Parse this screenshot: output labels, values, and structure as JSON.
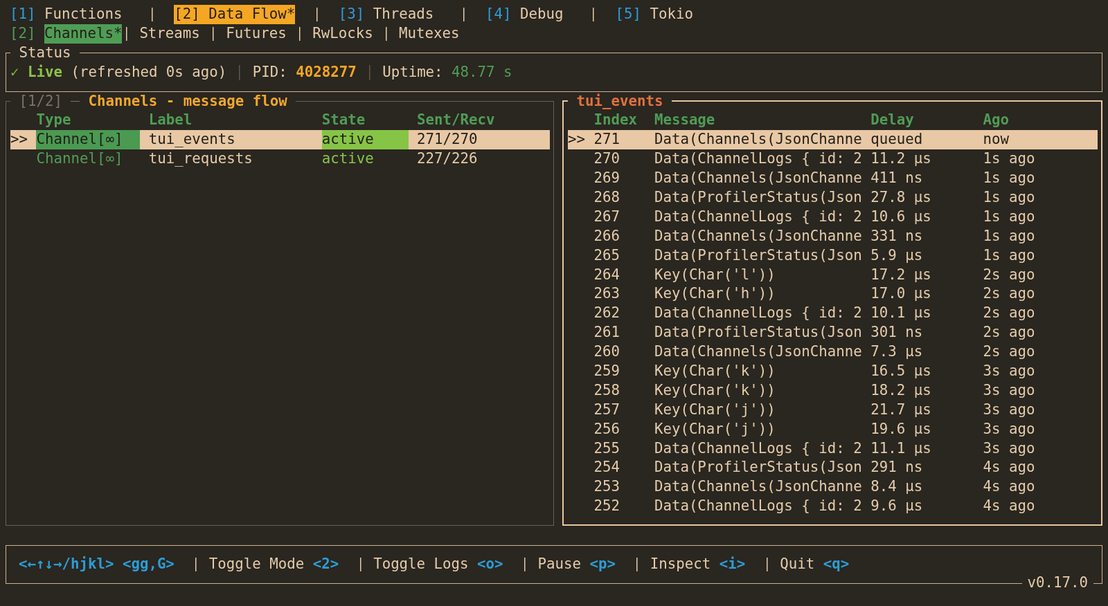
{
  "tabs": [
    {
      "number": "[1]",
      "label": "Functions",
      "selected": false
    },
    {
      "number": "[2]",
      "label": "Data Flow*",
      "selected": true
    },
    {
      "number": "[3]",
      "label": "Threads",
      "selected": false
    },
    {
      "number": "[4]",
      "label": "Debug",
      "selected": false
    },
    {
      "number": "[5]",
      "label": "Tokio",
      "selected": false
    }
  ],
  "subtabs": {
    "number": "[2]",
    "items": [
      {
        "label": "Channels*",
        "selected": true
      },
      {
        "label": "Streams",
        "selected": false
      },
      {
        "label": "Futures",
        "selected": false
      },
      {
        "label": "RwLocks",
        "selected": false
      },
      {
        "label": "Mutexes",
        "selected": false
      }
    ]
  },
  "status": {
    "title": "Status",
    "indicator": "✓",
    "state": "Live",
    "refreshed": "(refreshed 0s ago)",
    "pid_label": "PID:",
    "pid": "4028277",
    "uptime_label": "Uptime:",
    "uptime": "48.77 s"
  },
  "channels_panel": {
    "page": "[1/2]",
    "title": "Channels - message flow",
    "focused": false,
    "cursor": ">>",
    "columns": [
      "Type",
      "Label",
      "State",
      "Sent/Recv"
    ],
    "rows": [
      {
        "type": "Channel[∞]",
        "label": "tui_events",
        "state": "active",
        "sent_recv": "271/270",
        "selected": true
      },
      {
        "type": "Channel[∞]",
        "label": "tui_requests",
        "state": "active",
        "sent_recv": "227/226",
        "selected": false
      }
    ]
  },
  "events_panel": {
    "title": "tui_events",
    "focused": true,
    "cursor": ">>",
    "columns": [
      "Index",
      "Message",
      "Delay",
      "Ago"
    ],
    "rows": [
      {
        "index": "271",
        "message": "Data(Channels(JsonChanne",
        "delay": "queued",
        "ago": "now",
        "selected": true
      },
      {
        "index": "270",
        "message": "Data(ChannelLogs { id: 2",
        "delay": "11.2 µs",
        "ago": "1s ago",
        "selected": false
      },
      {
        "index": "269",
        "message": "Data(Channels(JsonChanne",
        "delay": "411 ns",
        "ago": "1s ago",
        "selected": false
      },
      {
        "index": "268",
        "message": "Data(ProfilerStatus(Json",
        "delay": "27.8 µs",
        "ago": "1s ago",
        "selected": false
      },
      {
        "index": "267",
        "message": "Data(ChannelLogs { id: 2",
        "delay": "10.6 µs",
        "ago": "1s ago",
        "selected": false
      },
      {
        "index": "266",
        "message": "Data(Channels(JsonChanne",
        "delay": "331 ns",
        "ago": "1s ago",
        "selected": false
      },
      {
        "index": "265",
        "message": "Data(ProfilerStatus(Json",
        "delay": "5.9 µs",
        "ago": "1s ago",
        "selected": false
      },
      {
        "index": "264",
        "message": "Key(Char('l'))",
        "delay": "17.2 µs",
        "ago": "2s ago",
        "selected": false
      },
      {
        "index": "263",
        "message": "Key(Char('h'))",
        "delay": "17.0 µs",
        "ago": "2s ago",
        "selected": false
      },
      {
        "index": "262",
        "message": "Data(ChannelLogs { id: 2",
        "delay": "10.1 µs",
        "ago": "2s ago",
        "selected": false
      },
      {
        "index": "261",
        "message": "Data(ProfilerStatus(Json",
        "delay": "301 ns",
        "ago": "2s ago",
        "selected": false
      },
      {
        "index": "260",
        "message": "Data(Channels(JsonChanne",
        "delay": "7.3 µs",
        "ago": "2s ago",
        "selected": false
      },
      {
        "index": "259",
        "message": "Key(Char('k'))",
        "delay": "16.5 µs",
        "ago": "3s ago",
        "selected": false
      },
      {
        "index": "258",
        "message": "Key(Char('k'))",
        "delay": "18.2 µs",
        "ago": "3s ago",
        "selected": false
      },
      {
        "index": "257",
        "message": "Key(Char('j'))",
        "delay": "21.7 µs",
        "ago": "3s ago",
        "selected": false
      },
      {
        "index": "256",
        "message": "Key(Char('j'))",
        "delay": "19.6 µs",
        "ago": "3s ago",
        "selected": false
      },
      {
        "index": "255",
        "message": "Data(ChannelLogs { id: 2",
        "delay": "11.1 µs",
        "ago": "3s ago",
        "selected": false
      },
      {
        "index": "254",
        "message": "Data(ProfilerStatus(Json",
        "delay": "291 ns",
        "ago": "4s ago",
        "selected": false
      },
      {
        "index": "253",
        "message": "Data(Channels(JsonChanne",
        "delay": "8.4 µs",
        "ago": "4s ago",
        "selected": false
      },
      {
        "index": "252",
        "message": "Data(ChannelLogs { id: 2",
        "delay": "9.6 µs",
        "ago": "4s ago",
        "selected": false
      }
    ]
  },
  "footer": {
    "nav_keys": [
      "<←↑↓→/hjkl>",
      "<gg,G>"
    ],
    "actions": [
      {
        "label": "Toggle Mode",
        "key": "<2>"
      },
      {
        "label": "Toggle Logs",
        "key": "<o>"
      },
      {
        "label": "Pause",
        "key": "<p>"
      },
      {
        "label": "Inspect",
        "key": "<i>"
      },
      {
        "label": "Quit",
        "key": "<q>"
      }
    ],
    "version": "v0.17.0"
  }
}
